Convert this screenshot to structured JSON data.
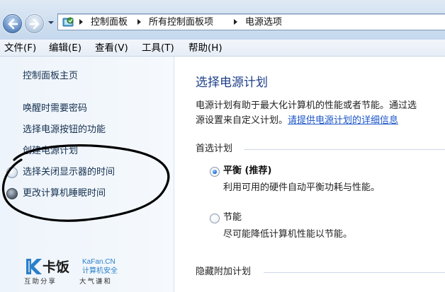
{
  "breadcrumb": {
    "items": [
      "控制面板",
      "所有控制面板项",
      "电源选项"
    ]
  },
  "menu": {
    "items": [
      "文件(F)",
      "编辑(E)",
      "查看(V)",
      "工具(T)",
      "帮助(H)"
    ]
  },
  "sidebar": {
    "home": "控制面板主页",
    "links": [
      "唤醒时需要密码",
      "选择电源按钮的功能",
      "创建电源计划",
      "选择关闭显示器的时间",
      "更改计算机睡眠时间"
    ]
  },
  "main": {
    "title": "选择电源计划",
    "desc_line1": "电源计划有助于最大化计算机的性能或者节能。通过选",
    "desc_line2_prefix": "源设置来自定义计划。",
    "desc_link": "请提供电源计划的详细信息",
    "preferred_label": "首选计划",
    "plans": [
      {
        "name": "平衡 (推荐)",
        "description": "利用可用的硬件自动平衡功耗与性能。",
        "selected": true
      },
      {
        "name": "节能",
        "description": "尽可能降低计算机性能以节能。",
        "selected": false
      }
    ],
    "hidden_label": "隐藏附加计划"
  },
  "watermark": {
    "brand": "卡饭",
    "url": "KaFan.CN",
    "subtitle": "计算机安全",
    "slogan_left": "互助分享",
    "slogan_right": "大气谦和"
  },
  "colors": {
    "title_blue": "#1e3f8a",
    "link_blue": "#1c56c9",
    "nav_link": "#15304f",
    "watermark_blue": "#2a7fc9"
  }
}
